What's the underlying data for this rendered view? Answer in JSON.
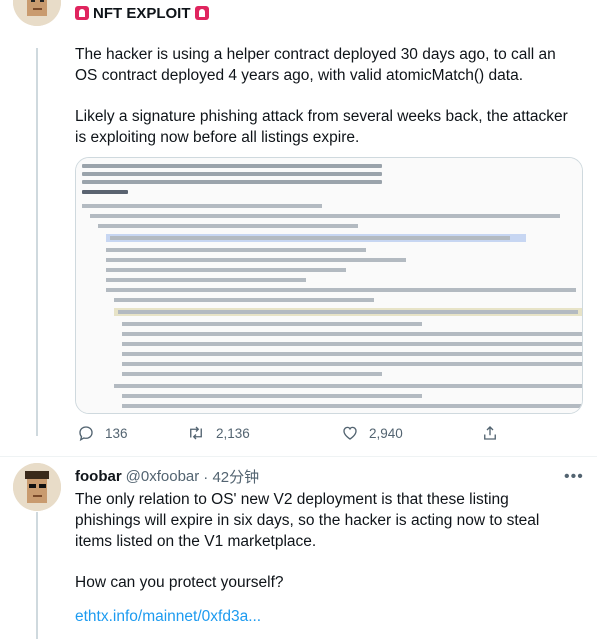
{
  "tweet1": {
    "title": "NFT EXPLOIT",
    "paragraph1": "The hacker is using a helper contract deployed 30 days ago, to call an OS contract deployed 4 years ago, with valid atomicMatch() data.",
    "paragraph2": "Likely a signature phishing attack from several weeks back, the attacker is exploiting now before all listings expire.",
    "actions": {
      "replies": "136",
      "retweets": "2,136",
      "likes": "2,940"
    }
  },
  "tweet2": {
    "display_name": "foobar",
    "handle": "@0xfoobar",
    "time": "· 42分钟",
    "paragraph1": "The only relation to OS' new V2 deployment is that these listing phishings will expire in six days, so the hacker is acting now to steal items listed on the V1 marketplace.",
    "paragraph2": "How can you protect yourself?",
    "link": "ethtx.info/mainnet/0xfd3a..."
  },
  "colors": {
    "link": "#1d9bf0",
    "muted": "#536471",
    "alert": "#e0245e",
    "text": "#0f1419"
  },
  "icons": [
    "siren-icon",
    "reply-icon",
    "retweet-icon",
    "like-icon",
    "share-icon",
    "more-icon"
  ]
}
